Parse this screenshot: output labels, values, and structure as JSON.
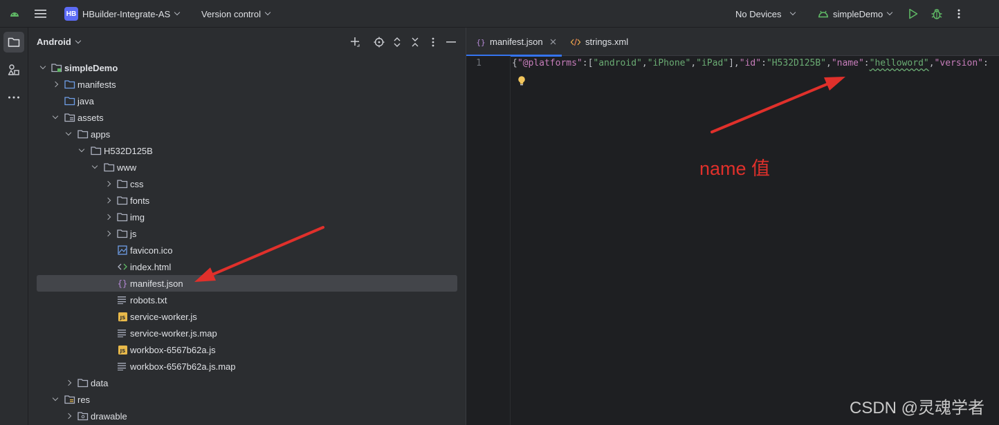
{
  "toolbar": {
    "project_badge": "HB",
    "project_name": "HBuilder-Integrate-AS",
    "vcs_label": "Version control",
    "devices_label": "No Devices",
    "run_config": "simpleDemo"
  },
  "project_panel": {
    "view_title": "Android",
    "tree": [
      {
        "label": "simpleDemo",
        "bold": true
      },
      {
        "label": "manifests"
      },
      {
        "label": "java"
      },
      {
        "label": "assets"
      },
      {
        "label": "apps"
      },
      {
        "label": "H532D125B"
      },
      {
        "label": "www"
      },
      {
        "label": "css"
      },
      {
        "label": "fonts"
      },
      {
        "label": "img"
      },
      {
        "label": "js"
      },
      {
        "label": "favicon.ico"
      },
      {
        "label": "index.html"
      },
      {
        "label": "manifest.json"
      },
      {
        "label": "robots.txt"
      },
      {
        "label": "service-worker.js"
      },
      {
        "label": "service-worker.js.map"
      },
      {
        "label": "workbox-6567b62a.js"
      },
      {
        "label": "workbox-6567b62a.js.map"
      },
      {
        "label": "data"
      },
      {
        "label": "res"
      },
      {
        "label": "drawable"
      }
    ]
  },
  "editor": {
    "tabs": [
      {
        "label": "manifest.json",
        "active": true
      },
      {
        "label": "strings.xml",
        "active": false
      }
    ],
    "line_number": "1",
    "code_tokens": [
      {
        "t": "{",
        "c": "p"
      },
      {
        "t": "\"@platforms\"",
        "c": "k"
      },
      {
        "t": ":[",
        "c": "p"
      },
      {
        "t": "\"android\"",
        "c": "s"
      },
      {
        "t": ",",
        "c": "p"
      },
      {
        "t": "\"iPhone\"",
        "c": "s"
      },
      {
        "t": ",",
        "c": "p"
      },
      {
        "t": "\"iPad\"",
        "c": "s"
      },
      {
        "t": "],",
        "c": "p"
      },
      {
        "t": "\"id\"",
        "c": "k"
      },
      {
        "t": ":",
        "c": "p"
      },
      {
        "t": "\"H532D125B\"",
        "c": "s"
      },
      {
        "t": ",",
        "c": "p"
      },
      {
        "t": "\"name\"",
        "c": "k"
      },
      {
        "t": ":",
        "c": "p"
      },
      {
        "t": "\"helloword\"",
        "c": "sw"
      },
      {
        "t": ",",
        "c": "p"
      },
      {
        "t": "\"version\"",
        "c": "k"
      },
      {
        "t": ":",
        "c": "p"
      }
    ]
  },
  "annotation": {
    "text": "name 值",
    "color": "#e0302b"
  },
  "watermark": "CSDN @灵魂学者",
  "colors": {
    "accent": "#3574f0",
    "folder": "#aeb3c2",
    "json_icon": "#b589d6",
    "js_badge": "#e8b94a",
    "run_green": "#5fb865"
  }
}
